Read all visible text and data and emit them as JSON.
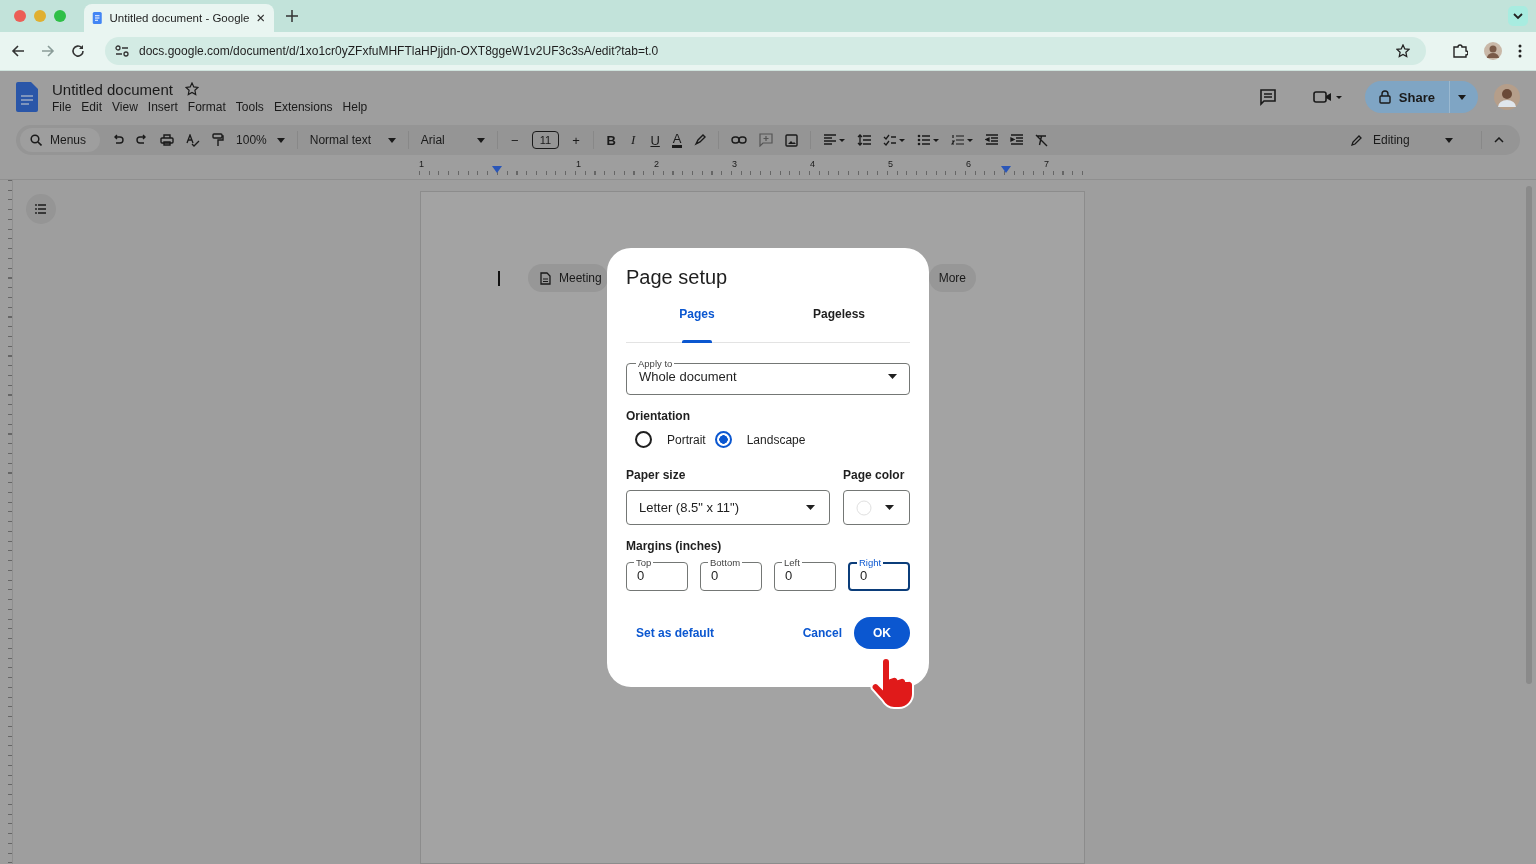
{
  "browser": {
    "tab": {
      "title": "Untitled document - Google"
    },
    "url": "docs.google.com/document/d/1xo1cr0yZFxfuMHFTlaHPjjdn-OXT8ggeW1v2UF3c3sA/edit?tab=t.0"
  },
  "doc": {
    "title": "Untitled document",
    "menus": [
      "File",
      "Edit",
      "View",
      "Insert",
      "Format",
      "Tools",
      "Extensions",
      "Help"
    ],
    "share": "Share"
  },
  "toolbar": {
    "search": "Menus",
    "zoom": "100%",
    "style": "Normal text",
    "font": "Arial",
    "font_size": "11",
    "minus": "−",
    "plus": "+",
    "bold": "B",
    "italic": "I",
    "underline": "U",
    "text_color": "A",
    "mode": "Editing"
  },
  "ruler": [
    "1",
    "1",
    "2",
    "3",
    "4",
    "5",
    "6",
    "7"
  ],
  "chips": [
    "Meeting",
    "More"
  ],
  "dialog": {
    "title": "Page setup",
    "tabs": [
      {
        "label": "Pages",
        "selected": true
      },
      {
        "label": "Pageless",
        "selected": false
      }
    ],
    "apply_to": {
      "label": "Apply to",
      "value": "Whole document"
    },
    "orientation": {
      "label": "Orientation",
      "options": [
        {
          "label": "Portrait",
          "selected": false
        },
        {
          "label": "Landscape",
          "selected": true
        }
      ]
    },
    "paper_size": {
      "label": "Paper size",
      "value": "Letter (8.5\" x 11\")"
    },
    "page_color": {
      "label": "Page color"
    },
    "margins": {
      "label": "Margins (inches)",
      "fields": [
        {
          "label": "Top",
          "value": "0",
          "focused": false
        },
        {
          "label": "Bottom",
          "value": "0",
          "focused": false
        },
        {
          "label": "Left",
          "value": "0",
          "focused": false
        },
        {
          "label": "Right",
          "value": "0",
          "focused": true
        }
      ]
    },
    "set_default": "Set as default",
    "cancel": "Cancel",
    "ok": "OK"
  }
}
